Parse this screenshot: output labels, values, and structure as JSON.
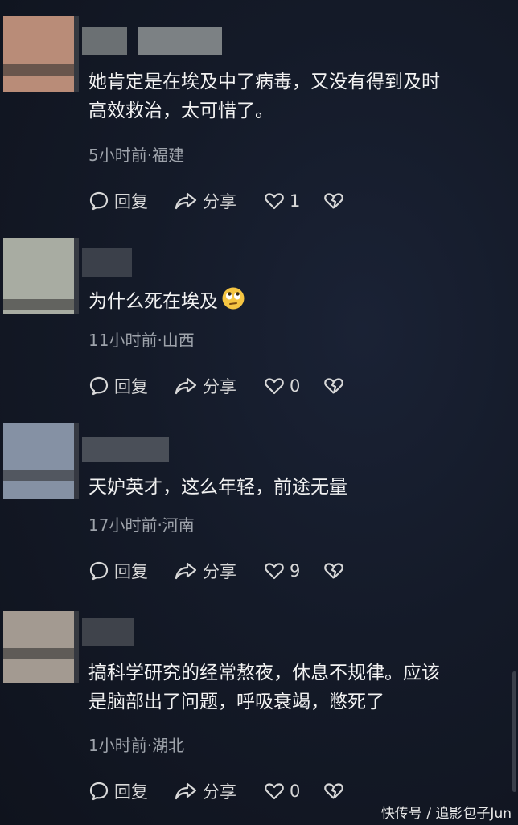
{
  "comments": [
    {
      "avatar_color": "#b98c78",
      "username_colors": [
        "#6b7073",
        "#7c8184"
      ],
      "text_lines": [
        "她肯定是在埃及中了病毒，又没有得到及时",
        "高效救治，太可惜了。"
      ],
      "meta": "5小时前·福建",
      "reply_label": "回复",
      "share_label": "分享",
      "like_count": "1"
    },
    {
      "avatar_color": "#a8aca2",
      "username_colors": [
        "#3b404a",
        "#3b404a"
      ],
      "text_lines": [
        "为什么死在埃及"
      ],
      "has_emoji": true,
      "meta": "11小时前·山西",
      "reply_label": "回复",
      "share_label": "分享",
      "like_count": "0"
    },
    {
      "avatar_color": "#8591a4",
      "username_colors": [
        "#4a4f58",
        "#4a4f58"
      ],
      "text_lines": [
        "天妒英才，这么年轻，前途无量"
      ],
      "meta": "17小时前·河南",
      "reply_label": "回复",
      "share_label": "分享",
      "like_count": "9"
    },
    {
      "avatar_color": "#a39a91",
      "username_colors": [
        "#3f434b",
        "#3f434b"
      ],
      "text_lines": [
        "搞科学研究的经常熬夜，休息不规律。应该",
        "是脑部出了问题，呼吸衰竭，憋死了"
      ],
      "meta": "1小时前·湖北",
      "reply_label": "回复",
      "share_label": "分享",
      "like_count": "0"
    }
  ],
  "watermark": "快传号 / 追影包子Jun"
}
